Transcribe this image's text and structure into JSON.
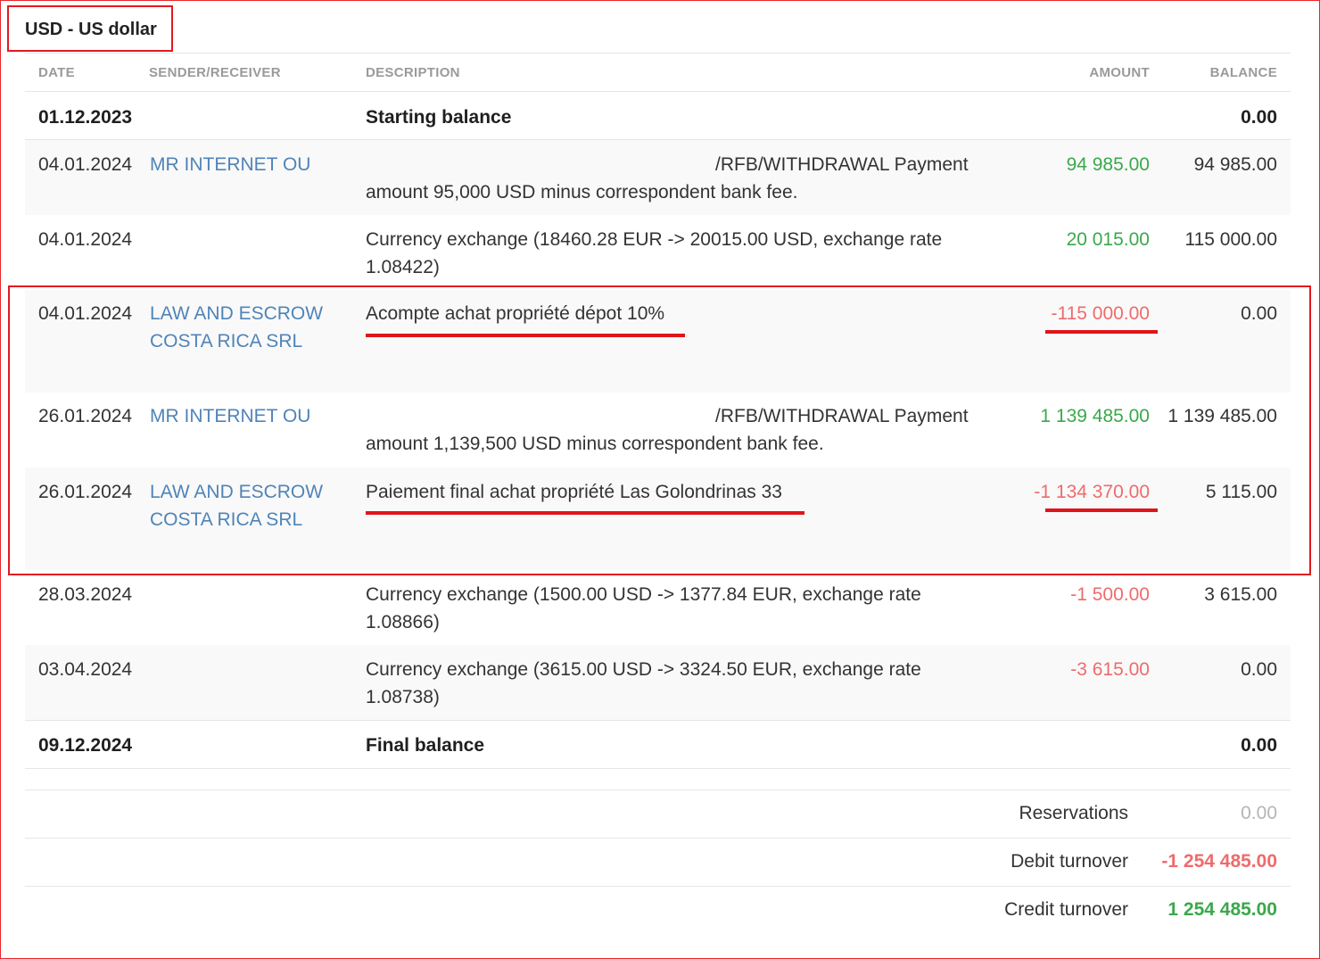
{
  "section": {
    "title": "USD - US dollar"
  },
  "headers": {
    "date": "DATE",
    "party": "SENDER/RECEIVER",
    "description": "DESCRIPTION",
    "amount": "AMOUNT",
    "balance": "BALANCE"
  },
  "start": {
    "date": "01.12.2023",
    "label": "Starting balance",
    "balance": "0.00"
  },
  "transactions": [
    {
      "date": "04.01.2024",
      "party": "MR INTERNET OU",
      "description": "/RFB/WITHDRAWAL Payment amount 95,000 USD minus correspondent bank fee.",
      "amount": "94 985.00",
      "balance": "94 985.00"
    },
    {
      "date": "04.01.2024",
      "party": "",
      "description": "Currency exchange (18460.28 EUR -> 20015.00 USD, exchange rate 1.08422)",
      "amount": "20 015.00",
      "balance": "115 000.00"
    },
    {
      "date": "04.01.2024",
      "party": "LAW AND ESCROW COSTA RICA SRL",
      "description": "Acompte achat propriété dépot 10%",
      "amount": "-115 000.00",
      "balance": "0.00"
    },
    {
      "date": "26.01.2024",
      "party": "MR INTERNET OU",
      "description": "/RFB/WITHDRAWAL Payment amount 1,139,500 USD minus correspondent bank fee.",
      "amount": "1 139 485.00",
      "balance": "1 139 485.00"
    },
    {
      "date": "26.01.2024",
      "party": "LAW AND ESCROW COSTA RICA SRL",
      "description": "Paiement final achat propriété Las Golondrinas 33",
      "amount": "-1 134 370.00",
      "balance": "5 115.00"
    },
    {
      "date": "28.03.2024",
      "party": "",
      "description": "Currency exchange (1500.00 USD -> 1377.84 EUR, exchange rate 1.08866)",
      "amount": "-1 500.00",
      "balance": "3 615.00"
    },
    {
      "date": "03.04.2024",
      "party": "",
      "description": "Currency exchange (3615.00 USD -> 3324.50 EUR, exchange rate 1.08738)",
      "amount": "-3 615.00",
      "balance": "0.00"
    }
  ],
  "final": {
    "date": "09.12.2024",
    "label": "Final balance",
    "balance": "0.00"
  },
  "summary": {
    "reservations_label": "Reservations",
    "reservations_value": "0.00",
    "debit_label": "Debit turnover",
    "debit_value": "-1 254 485.00",
    "credit_label": "Credit turnover",
    "credit_value": "1 254 485.00"
  },
  "colors": {
    "positive": "#3aa84c",
    "negative": "#ef6b6b",
    "link": "#4f84b8",
    "highlight": "#e3191f"
  }
}
